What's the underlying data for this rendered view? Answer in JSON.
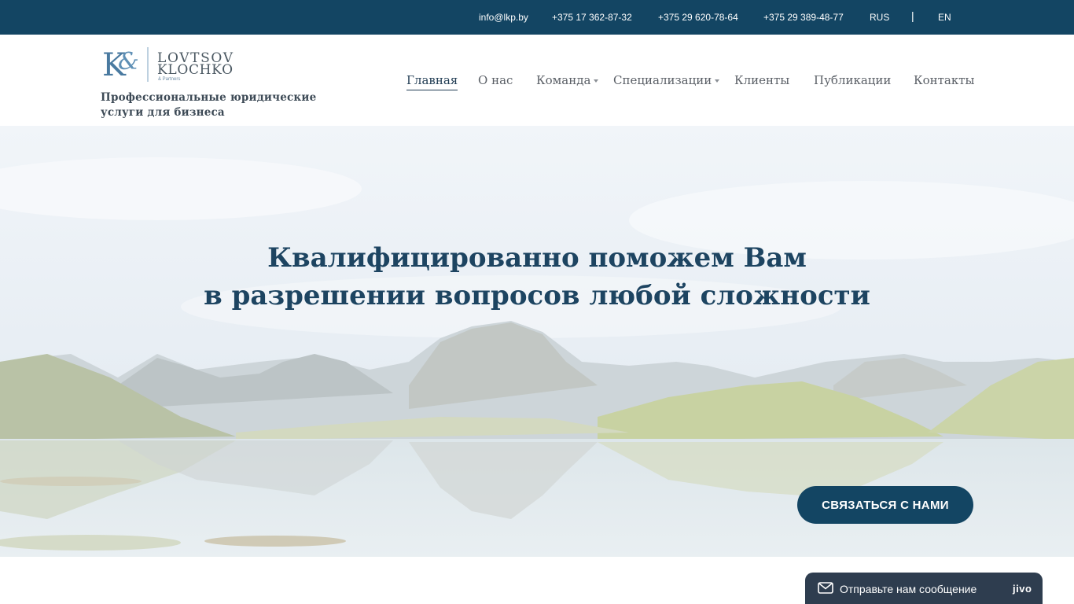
{
  "topbar": {
    "email": "info@lkp.by",
    "phone1": "+375 17 362-87-32",
    "phone2": "+375 29 620-78-64",
    "phone3": "+375 29 389-48-77",
    "lang_ru": "RUS",
    "separator": "|",
    "lang_en": "EN"
  },
  "logo": {
    "monogram_k": "K",
    "monogram_amp": "&",
    "line1": "LOVTSOV",
    "line2": "KLOCHKO",
    "line3": "& Partners"
  },
  "header": {
    "tagline_line1": "Профессиональные юридические",
    "tagline_line2": "услуги для бизнеса"
  },
  "nav": {
    "items": [
      {
        "label": "Главная",
        "active": true
      },
      {
        "label": "О нас"
      },
      {
        "label": "Команда",
        "has_dropdown": true
      },
      {
        "label": "Специализации",
        "has_dropdown": true
      },
      {
        "label": "Клиенты"
      },
      {
        "label": "Публикации"
      },
      {
        "label": "Контакты"
      }
    ]
  },
  "hero": {
    "title_line1": "Квалифицированно поможем Вам",
    "title_line2": "в разрешении вопросов любой сложности",
    "cta_label": "СВЯЗАТЬСЯ С НАМИ"
  },
  "chat": {
    "label": "Отправьте нам сообщение",
    "brand": "jivo",
    "icon": "envelope-icon"
  },
  "colors": {
    "brand_dark": "#134563",
    "title_color": "#1d4461",
    "chat_bg": "#2e3d4f"
  }
}
